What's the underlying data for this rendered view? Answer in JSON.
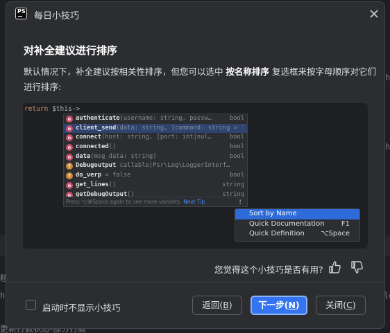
{
  "dialog": {
    "title": "每日小技巧",
    "heading": "对补全建议进行排序",
    "description_before": "默认情况下，补全建议按相关性排序，但您可以选中 ",
    "description_bold": "按名称排序",
    "description_after": " 复选框来按字母顺序对它们进行排序:"
  },
  "editor": {
    "keyword": "return",
    "expression": "$this->"
  },
  "completion": {
    "items": [
      {
        "icon": "m",
        "name": "authenticate",
        "params": "(username: string, passw…",
        "type": "bool"
      },
      {
        "icon": "m",
        "name": "client_send",
        "params": "(data: string, [command: string = '",
        "type": "",
        "selected": true
      },
      {
        "icon": "m",
        "name": "connect",
        "params": "(host: string, [port: int|nul…",
        "type": "bool"
      },
      {
        "icon": "m",
        "name": "connected",
        "params": "()",
        "type": "bool"
      },
      {
        "icon": "m",
        "name": "data",
        "params": "(msg_data: string)",
        "type": "bool"
      },
      {
        "icon": "f",
        "name": "Debugoutput",
        "params": "   callable|Psr\\Log\\LoggerInterf…",
        "type": ""
      },
      {
        "icon": "f",
        "name": "do_verp",
        "params": " = false",
        "type": "bool"
      },
      {
        "icon": "m",
        "name": "get_lines",
        "params": "()",
        "type": "string"
      },
      {
        "icon": "m",
        "name": "getDebugOutput",
        "params": "()",
        "type": "string"
      }
    ],
    "footer_text": "Press ⌥⌘Space again to see more variants",
    "footer_link": "Next Tip",
    "more_icon": "⋮"
  },
  "context_menu": {
    "items": [
      {
        "label": "Sort by Name",
        "shortcut": "",
        "selected": true
      },
      {
        "label": "Quick Documentation",
        "shortcut": "F1"
      },
      {
        "label": "Quick Definition",
        "shortcut": "⌥Space"
      }
    ]
  },
  "feedback": {
    "question": "您觉得这个小技巧是否有用?"
  },
  "footer": {
    "checkbox_label": "启动时不显示小技巧",
    "back_label": "返回(",
    "back_key": "B",
    "next_label": "下一步(",
    "next_key": "N",
    "close_label": "关闭(",
    "close_key": "C",
    "paren": ")"
  },
  "colors": {
    "accent": "#3574f0",
    "dialog_bg": "#2b2d30",
    "editor_bg": "#1e1f22"
  }
}
